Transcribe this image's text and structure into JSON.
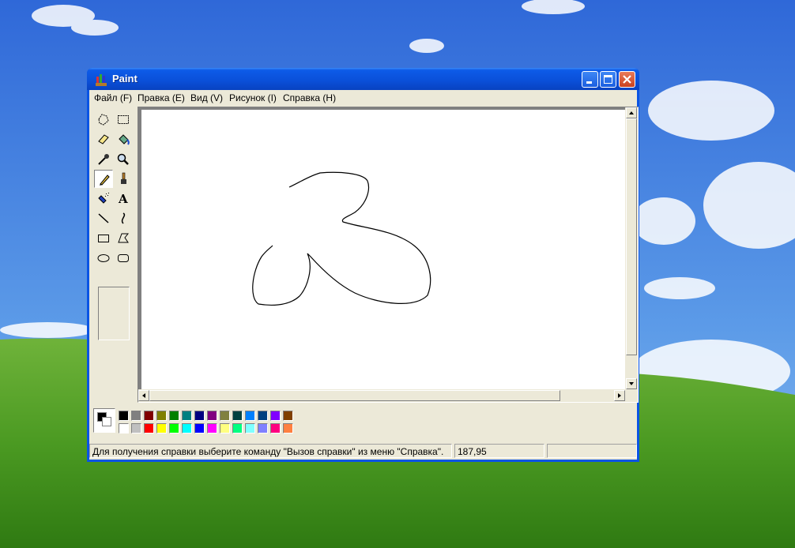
{
  "window": {
    "title": "Paint",
    "controls": {
      "minimize": "minimize-icon",
      "maximize": "maximize-icon",
      "close": "close-icon"
    }
  },
  "menu": [
    {
      "label": "Файл (F)"
    },
    {
      "label": "Правка (E)"
    },
    {
      "label": "Вид (V)"
    },
    {
      "label": "Рисунок (I)"
    },
    {
      "label": "Справка (H)"
    }
  ],
  "tools": [
    {
      "id": "free-form-select",
      "icon": "free-form-select-icon"
    },
    {
      "id": "select",
      "icon": "rect-select-icon"
    },
    {
      "id": "eraser",
      "icon": "eraser-icon"
    },
    {
      "id": "fill",
      "icon": "fill-bucket-icon"
    },
    {
      "id": "pick-color",
      "icon": "eyedropper-icon"
    },
    {
      "id": "magnifier",
      "icon": "magnifier-icon"
    },
    {
      "id": "pencil",
      "icon": "pencil-icon",
      "selected": true
    },
    {
      "id": "brush",
      "icon": "brush-icon"
    },
    {
      "id": "airbrush",
      "icon": "airbrush-icon"
    },
    {
      "id": "text",
      "icon": "text-icon",
      "glyph": "A"
    },
    {
      "id": "line",
      "icon": "line-icon"
    },
    {
      "id": "curve",
      "icon": "curve-icon"
    },
    {
      "id": "rectangle",
      "icon": "rectangle-icon"
    },
    {
      "id": "polygon",
      "icon": "polygon-icon"
    },
    {
      "id": "ellipse",
      "icon": "ellipse-icon"
    },
    {
      "id": "rounded-rectangle",
      "icon": "rounded-rectangle-icon"
    }
  ],
  "colors": {
    "foreground": "#000000",
    "background": "#ffffff",
    "palette_top": [
      "#000000",
      "#808080",
      "#800000",
      "#808000",
      "#008000",
      "#008080",
      "#000080",
      "#800080",
      "#808040",
      "#004040",
      "#0080ff",
      "#004080",
      "#8000ff",
      "#804000"
    ],
    "palette_bottom": [
      "#ffffff",
      "#c0c0c0",
      "#ff0000",
      "#ffff00",
      "#00ff00",
      "#00ffff",
      "#0000ff",
      "#ff00ff",
      "#ffff80",
      "#00ff80",
      "#80ffff",
      "#8080ff",
      "#ff0080",
      "#ff8040"
    ]
  },
  "status": {
    "help_text": "Для получения справки выберите команду \"Вызов справки\" из меню \"Справка\".",
    "coordinates": "187,95",
    "size": ""
  }
}
